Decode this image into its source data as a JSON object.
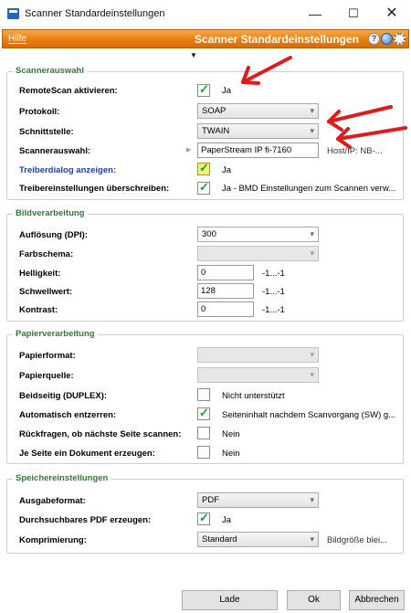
{
  "window": {
    "title": "Scanner Standardeinstellungen",
    "minimize_glyph": "—",
    "maximize_glyph": "☐",
    "close_glyph": "✕"
  },
  "toolbar": {
    "menu_help": "Hilfe",
    "title": "Scanner Standardeinstellungen",
    "icons": [
      "help-icon",
      "globe-icon",
      "gear-icon"
    ],
    "dropdown_glyph": "▼"
  },
  "colors": {
    "accent_orange": "#e97f12",
    "group_title_green": "#2e7d32",
    "link_blue": "#1f3fb0",
    "annotation_red": "#e01b1b"
  },
  "scannerauswahl": {
    "title": "Scannerauswahl",
    "remotescan": {
      "label": "RemoteScan aktivieren:",
      "checked": true,
      "text": "Ja"
    },
    "protokoll": {
      "label": "Protokoll:",
      "value": "SOAP"
    },
    "schnittstelle": {
      "label": "Schnittstelle:",
      "value": "TWAIN"
    },
    "scanner": {
      "label": "Scannerauswahl:",
      "value": "PaperStream IP fi-7160",
      "host": "Host/IP: NB-..."
    },
    "treiberdialog": {
      "label": "Treiberdialog anzeigen:",
      "checked": true,
      "text": "Ja"
    },
    "ueberschreiben": {
      "label": "Treibereinstellungen überschreiben:",
      "checked": true,
      "text": "Ja - BMD Einstellungen zum Scannen verw..."
    }
  },
  "bildverarbeitung": {
    "title": "Bildverarbeitung",
    "aufloesung": {
      "label": "Auflösung (DPI):",
      "value": "300"
    },
    "farbschema": {
      "label": "Farbschema:",
      "value": ""
    },
    "helligkeit": {
      "label": "Helligkeit:",
      "value": "0",
      "range": "-1...-1"
    },
    "schwellwert": {
      "label": "Schwellwert:",
      "value": "128",
      "range": "-1...-1"
    },
    "kontrast": {
      "label": "Kontrast:",
      "value": "0",
      "range": "-1...-1"
    }
  },
  "papierverarbeitung": {
    "title": "Papierverarbeitung",
    "papierformat": {
      "label": "Papierformat:",
      "value": ""
    },
    "papierquelle": {
      "label": "Papierquelle:",
      "value": ""
    },
    "beidseitig": {
      "label": "Beidseitig (DUPLEX):",
      "checked": false,
      "text": "Nicht unterstützt"
    },
    "entzerren": {
      "label": "Automatisch entzerren:",
      "checked": true,
      "text": "Seiteninhalt nachdem Scanvorgang (SW) g..."
    },
    "rueckfragen": {
      "label": "Rückfragen, ob nächste Seite scannen:",
      "checked": false,
      "text": "Nein"
    },
    "jeseite": {
      "label": "Je Seite ein Dokument erzeugen:",
      "checked": false,
      "text": "Nein"
    }
  },
  "speichereinstellungen": {
    "title": "Speichereinstellungen",
    "ausgabeformat": {
      "label": "Ausgabeformat:",
      "value": "PDF"
    },
    "durchsuchbar": {
      "label": "Durchsuchbares PDF erzeugen:",
      "checked": true,
      "text": "Ja"
    },
    "komprimierung": {
      "label": "Komprimierung:",
      "value": "Standard",
      "note": "Bildgröße blei..."
    }
  },
  "buttons": {
    "lade": "Lade Geräteeinstellungen",
    "ok": "Ok",
    "abbrechen": "Abbrechen"
  }
}
